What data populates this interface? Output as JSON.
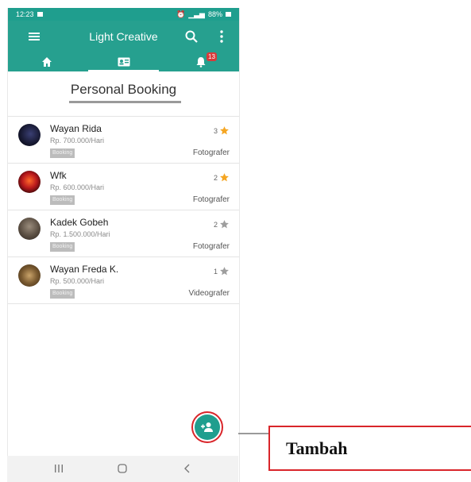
{
  "status_bar": {
    "time": "12:23",
    "battery": "88%"
  },
  "app_bar": {
    "title": "Light Creative"
  },
  "tabs": [
    {
      "icon": "home-icon"
    },
    {
      "icon": "contact-card-icon",
      "active": true
    },
    {
      "icon": "bell-icon",
      "badge": "13"
    }
  ],
  "page_title": "Personal Booking",
  "bookings": [
    {
      "name": "Wayan Rida",
      "price": "Rp. 700.000/Hari",
      "button": "Booking",
      "rating": "3",
      "star_color": "#f5a623",
      "role": "Fotografer"
    },
    {
      "name": "Wfk",
      "price": "Rp. 600.000/Hari",
      "button": "Booking",
      "rating": "2",
      "star_color": "#f5a623",
      "role": "Fotografer"
    },
    {
      "name": "Kadek Gobeh",
      "price": "Rp. 1.500.000/Hari",
      "button": "Booking",
      "rating": "2",
      "star_color": "#9e9e9e",
      "role": "Fotografer"
    },
    {
      "name": "Wayan Freda K.",
      "price": "Rp. 500.000/Hari",
      "button": "Booking",
      "rating": "1",
      "star_color": "#9e9e9e",
      "role": "Videografer"
    }
  ],
  "fab": {
    "icon": "add-person-icon"
  },
  "callout": {
    "label": "Tambah"
  },
  "colors": {
    "primary": "#26a08f",
    "badge": "#d83a3a",
    "highlight": "#d9252a"
  }
}
